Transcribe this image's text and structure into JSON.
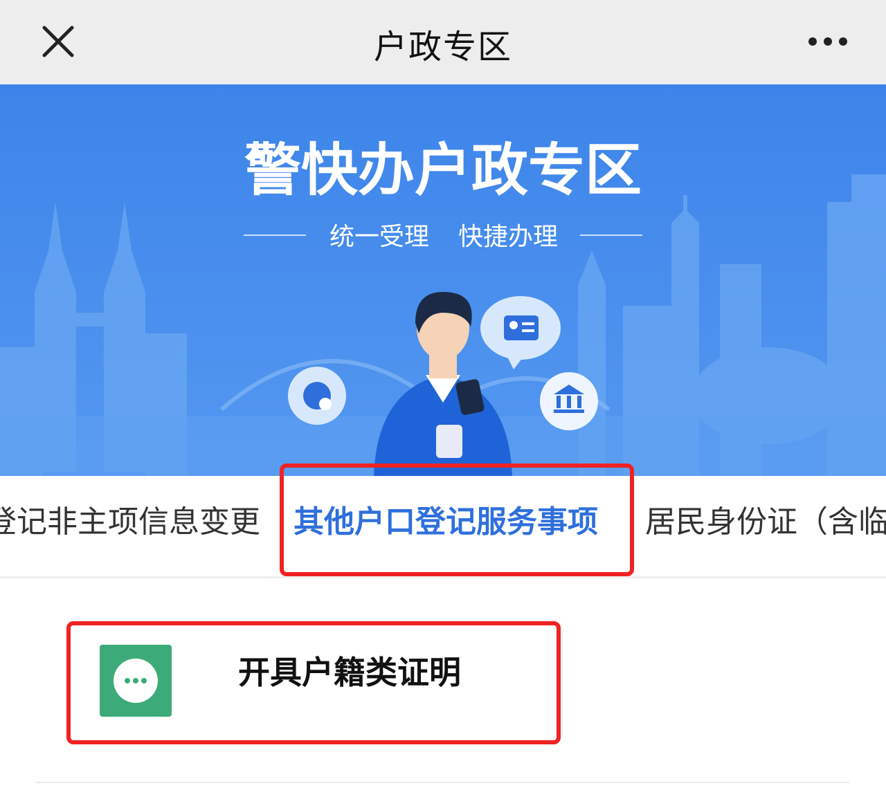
{
  "header": {
    "title": "户政专区"
  },
  "banner": {
    "title_main": "警快办户政专区",
    "slogan_left": "统一受理",
    "slogan_right": "快捷办理"
  },
  "tabs": [
    {
      "label": "登记非主项信息变更"
    },
    {
      "label": "其他户口登记服务事项"
    },
    {
      "label": "居民身份证（含临"
    }
  ],
  "services": [
    {
      "label": "开具户籍类证明",
      "icon": "more-dots-icon"
    }
  ],
  "colors": {
    "accent": "#2e6fdc",
    "highlight": "#f02222",
    "service_icon_bg": "#3dab79",
    "banner_bg": "#3b82e8"
  }
}
